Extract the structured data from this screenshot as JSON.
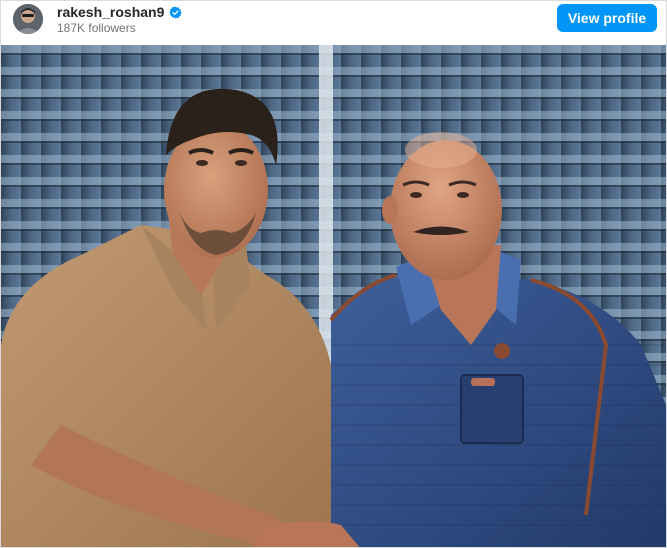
{
  "post_header": {
    "username": "rakesh_roshan9",
    "verified": true,
    "followers_text": "187K followers",
    "avatar_icon": "profile-avatar",
    "verified_icon": "verified-badge-icon",
    "view_profile_label": "View profile"
  },
  "colors": {
    "button_bg": "#0095f6",
    "button_text": "#ffffff",
    "username": "#262626",
    "secondary_text": "#737373",
    "verified_badge": "#0095f6"
  },
  "photo": {
    "subject_left_shirt_color": "#b08a63",
    "subject_right_shirt_color": "#2f4f8f",
    "background_blinds_color": "#3c5067"
  }
}
